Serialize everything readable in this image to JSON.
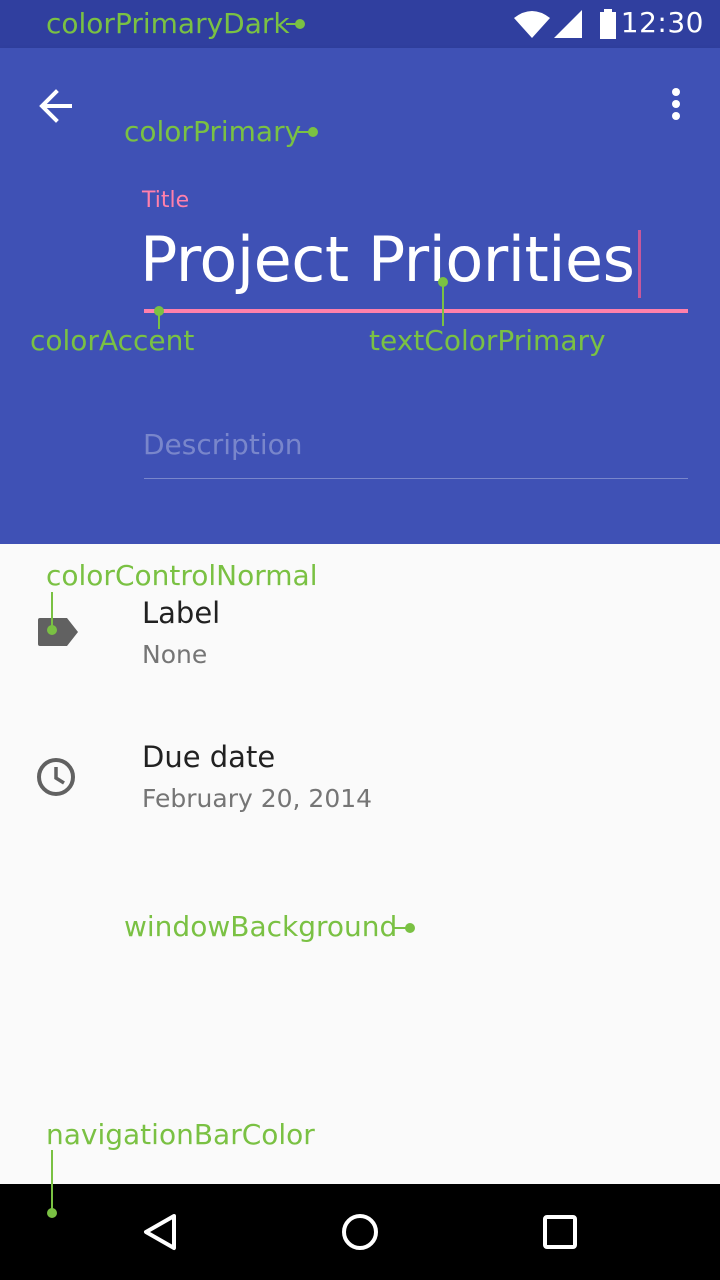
{
  "status": {
    "time": "12:30"
  },
  "toolbar": {
    "back_icon": "arrow-back-icon",
    "more_icon": "more-vert-icon"
  },
  "form": {
    "title_label": "Title",
    "title_value": "Project Priorities",
    "description_placeholder": "Description"
  },
  "items": [
    {
      "icon": "label-tag-icon",
      "title": "Label",
      "subtitle": "None"
    },
    {
      "icon": "clock-icon",
      "title": "Due date",
      "subtitle": "February 20, 2014"
    }
  ],
  "annotations": {
    "color_primary_dark": "colorPrimaryDark",
    "color_primary": "colorPrimary",
    "color_accent": "colorAccent",
    "text_color_primary": "textColorPrimary",
    "color_control_normal": "colorControlNormal",
    "window_background": "windowBackground",
    "navigation_bar_color": "navigationBarColor"
  },
  "navbar": {
    "back_icon": "nav-back-icon",
    "home_icon": "nav-home-icon",
    "recents_icon": "nav-recents-icon"
  },
  "colors": {
    "primary_dark": "#303f9f",
    "primary": "#3f51b5",
    "accent": "#ff80ab",
    "window_background": "#fafafa",
    "navigation_bar": "#000000",
    "annotation": "#7ac143"
  }
}
